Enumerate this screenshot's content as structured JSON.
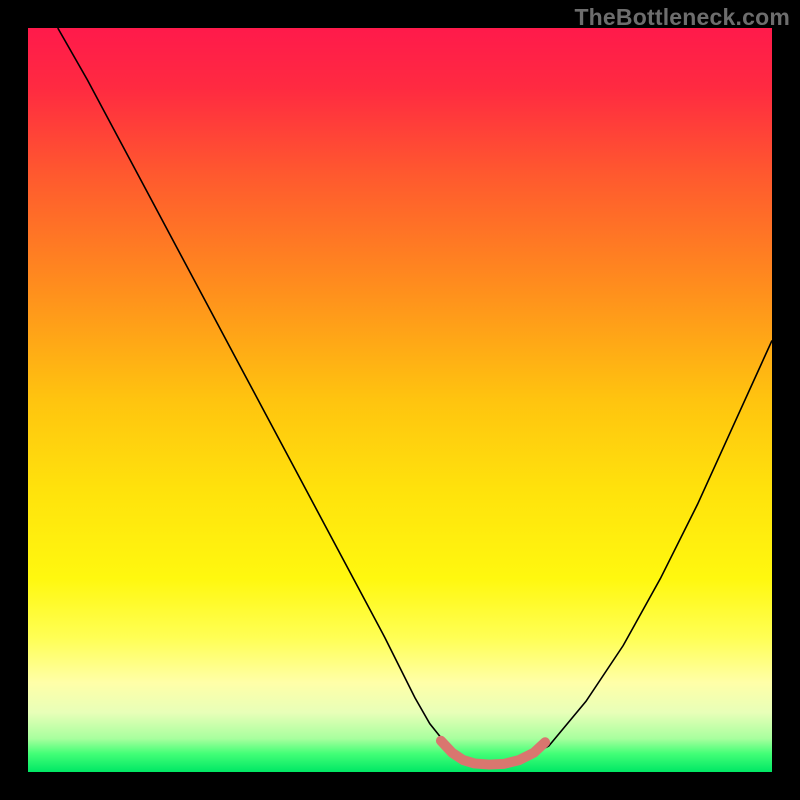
{
  "watermark": "TheBottleneck.com",
  "chart_data": {
    "type": "line",
    "title": "",
    "xlabel": "",
    "ylabel": "",
    "xlim": [
      0,
      100
    ],
    "ylim": [
      0,
      100
    ],
    "grid": false,
    "legend": false,
    "background_gradient": {
      "stops": [
        {
          "offset": 0.0,
          "color": "#ff1a4b"
        },
        {
          "offset": 0.08,
          "color": "#ff2a41"
        },
        {
          "offset": 0.2,
          "color": "#ff5a2e"
        },
        {
          "offset": 0.35,
          "color": "#ff8e1d"
        },
        {
          "offset": 0.5,
          "color": "#ffc40f"
        },
        {
          "offset": 0.62,
          "color": "#ffe20c"
        },
        {
          "offset": 0.74,
          "color": "#fff80f"
        },
        {
          "offset": 0.82,
          "color": "#ffff55"
        },
        {
          "offset": 0.88,
          "color": "#ffffa8"
        },
        {
          "offset": 0.92,
          "color": "#e8ffb8"
        },
        {
          "offset": 0.955,
          "color": "#a8ff9e"
        },
        {
          "offset": 0.975,
          "color": "#44ff77"
        },
        {
          "offset": 1.0,
          "color": "#00e765"
        }
      ]
    },
    "series": [
      {
        "name": "bottleneck-curve",
        "stroke": "#000000",
        "stroke_width": 1.6,
        "x": [
          4,
          8,
          12,
          16,
          20,
          24,
          28,
          32,
          36,
          40,
          44,
          48,
          50,
          52,
          54,
          56,
          58,
          60,
          62,
          65,
          70,
          75,
          80,
          85,
          90,
          95,
          100
        ],
        "y": [
          100,
          93,
          85.5,
          78,
          70.5,
          63,
          55.5,
          48,
          40.5,
          33,
          25.5,
          18,
          14,
          10,
          6.5,
          4,
          2.3,
          1.3,
          1,
          1,
          3.5,
          9.5,
          17,
          26,
          36,
          47,
          58
        ]
      },
      {
        "name": "optimal-range-marker",
        "stroke": "#d9766f",
        "stroke_width": 10,
        "linecap": "round",
        "x": [
          55.5,
          57,
          58.5,
          60,
          62,
          64,
          66,
          68,
          69.5
        ],
        "y": [
          4.2,
          2.6,
          1.6,
          1.15,
          1.0,
          1.1,
          1.6,
          2.6,
          4.0
        ]
      }
    ]
  }
}
